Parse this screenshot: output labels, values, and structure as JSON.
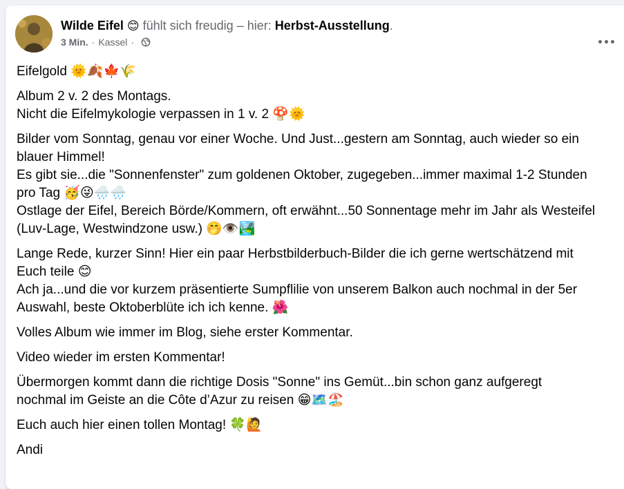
{
  "post": {
    "author": "Wilde Eifel",
    "author_emoji": "😊",
    "feeling_text": "fühlt sich freudig – hier:",
    "place": "Herbst-Ausstellung",
    "place_suffix": ".",
    "time": "3 Min.",
    "separator": "·",
    "location": "Kassel",
    "separator2": "·",
    "audience_icon": "globe-icon",
    "more_icon": "more-options-icon"
  },
  "paragraphs": [
    {
      "lines": [
        "Eifelgold 🌞🍂🍁🌾"
      ]
    },
    {
      "lines": [
        "Album 2 v. 2 des Montags.",
        "Nicht die Eifelmykologie verpassen in 1 v. 2 🍄🌞"
      ]
    },
    {
      "lines": [
        "Bilder vom Sonntag, genau vor einer Woche. Und Just...gestern am Sonntag, auch wieder so ein",
        "blauer Himmel!",
        "Es gibt sie...die \"Sonnenfenster\" zum goldenen Oktober, zugegeben...immer maximal 1-2 Stunden",
        "pro Tag 🥳😜🌧️🌧️",
        "Ostlage der Eifel, Bereich Börde/Kommern, oft erwähnt...50 Sonnentage mehr im Jahr als Westeifel",
        "(Luv-Lage, Westwindzone usw.) 🤭👁️🏞️"
      ]
    },
    {
      "lines": [
        "Lange Rede, kurzer Sinn! Hier ein paar Herbstbilderbuch-Bilder die ich gerne wertschätzend mit",
        "Euch teile 😊",
        "Ach ja...und die vor kurzem präsentierte Sumpflilie von unserem Balkon auch nochmal in der 5er",
        "Auswahl, beste Oktoberblüte ich ich kenne. 🌺"
      ]
    },
    {
      "lines": [
        "Volles Album wie immer im Blog, siehe erster Kommentar."
      ]
    },
    {
      "lines": [
        "Video wieder im ersten Kommentar!"
      ]
    },
    {
      "lines": [
        "Übermorgen kommt dann die richtige Dosis \"Sonne\" ins Gemüt...bin schon ganz aufgeregt",
        "nochmal im Geiste an die Côte d’Azur zu reisen 😁🗺️🏖️"
      ]
    },
    {
      "lines": [
        "Euch auch hier einen tollen Montag! 🍀🙋"
      ]
    },
    {
      "lines": [
        "Andi"
      ]
    }
  ]
}
